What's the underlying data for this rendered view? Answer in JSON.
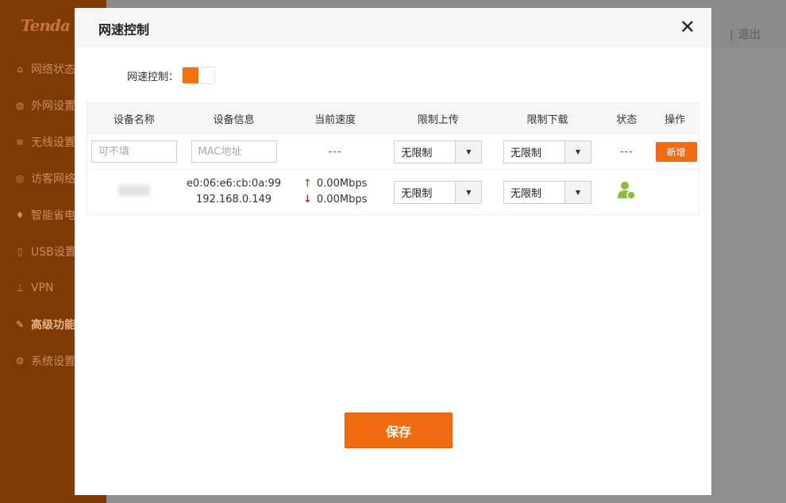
{
  "background": {
    "logo": "Tenda",
    "nav": [
      {
        "icon": "network-status-icon",
        "glyph": "⌂",
        "label": "网络状态"
      },
      {
        "icon": "globe-icon",
        "glyph": "◍",
        "label": "外网设置"
      },
      {
        "icon": "wifi-icon",
        "glyph": "≋",
        "label": "无线设置"
      },
      {
        "icon": "guest-network-icon",
        "glyph": "◎",
        "label": "访客网络"
      },
      {
        "icon": "power-save-icon",
        "glyph": "♦",
        "label": "智能省电"
      },
      {
        "icon": "usb-icon",
        "glyph": "▯",
        "label": "USB设置"
      },
      {
        "icon": "vpn-icon",
        "glyph": "⊥",
        "label": "VPN"
      },
      {
        "icon": "wrench-icon",
        "glyph": "✎",
        "label": "高级功能"
      },
      {
        "icon": "system-gear-icon",
        "glyph": "⚙",
        "label": "系统设置"
      }
    ],
    "logout_separator": "|",
    "logout": "退出"
  },
  "modal": {
    "title": "网速控制",
    "close_glyph": "✕",
    "toggle_label": "网速控制：",
    "toggle_on": true,
    "columns": [
      "设备名称",
      "设备信息",
      "当前速度",
      "限制上传",
      "限制下载",
      "状态",
      "操作"
    ],
    "new_row": {
      "name_placeholder": "可不填",
      "mac_placeholder": "MAC地址",
      "speed": "---",
      "upload_limit": "无限制",
      "download_limit": "无限制",
      "status": "---",
      "add_button": "新增"
    },
    "devices": [
      {
        "mac": "e0:06:e6:cb:0a:99",
        "ip": "192.168.0.149",
        "up_arrow": "↑",
        "down_arrow": "↓",
        "up_speed": "0.00Mbps",
        "down_speed": "0.00Mbps",
        "upload_limit": "无限制",
        "download_limit": "无限制",
        "status_icon": "user-online-icon"
      }
    ],
    "save_button": "保存"
  },
  "colors": {
    "accent": "#ef6c10",
    "sidebar": "#7e3b05",
    "overlay": "#8f8f8f",
    "online_green": "#8dbb3c",
    "up_arrow": "#2e9a3b",
    "down_arrow": "#d32020"
  }
}
